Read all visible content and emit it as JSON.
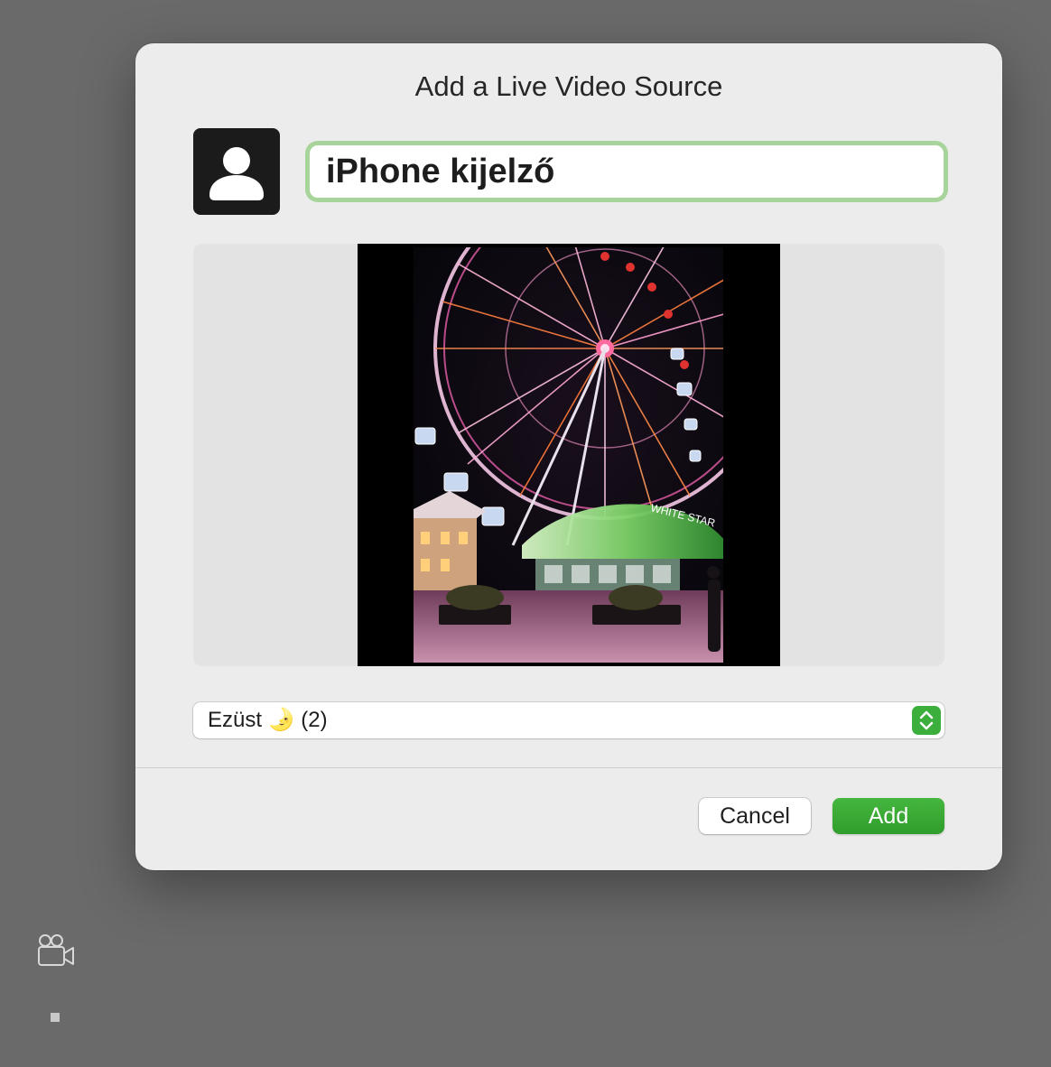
{
  "dialog": {
    "title": "Add a Live Video Source",
    "name_value": "iPhone kijelző",
    "avatar_icon": "person-icon",
    "preview": {
      "content": "ferris-wheel-night-photo",
      "sign_text": "WHITE STAR"
    },
    "device_select": {
      "value": "Ezüst 🌛 (2)",
      "icon": "up-down-chevron-icon",
      "accent": "#3cae3c"
    },
    "buttons": {
      "cancel": "Cancel",
      "add": "Add"
    },
    "accent_color": "#35a833",
    "focus_ring_color": "#a6d49a"
  },
  "background": {
    "icons": [
      "video-camera-icon",
      "stop-square-icon"
    ]
  }
}
